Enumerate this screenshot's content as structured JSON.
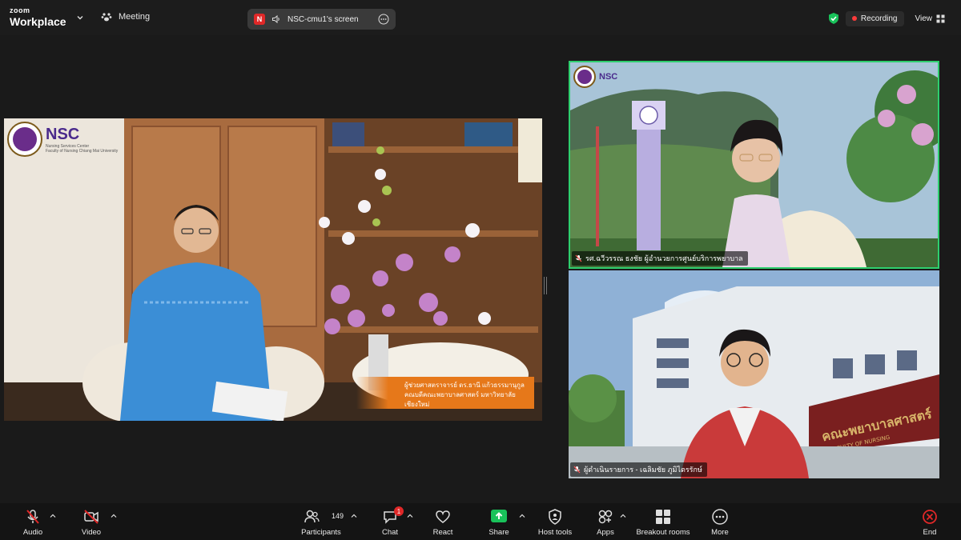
{
  "app": {
    "brand_small": "zoom",
    "brand_large": "Workplace"
  },
  "header": {
    "meeting_label": "Meeting",
    "share_badge": "N",
    "share_label": "NSC-cmu1's screen",
    "recording_label": "Recording",
    "view_label": "View"
  },
  "main_video": {
    "logo_text": "NSC",
    "logo_sub1": "Nursing Services Center",
    "logo_sub2": "Faculty of Nursing Chiang Mai University",
    "banner_line1": "ผู้ช่วยศาสตราจารย์ ดร.ธานี แก้วธรรมานุกูล",
    "banner_line2": "คณบดีคณะพยาบาลศาสตร์ มหาวิทยาลัยเชียงใหม่"
  },
  "tiles": [
    {
      "name": "รศ.ฉวีวรรณ ธงชัย ผู้อำนวยการศูนย์บริการพยาบาล",
      "logo_text": "NSC",
      "active": true
    },
    {
      "name": "ผู้ดำเนินรายการ - เฉลิมชัย ภูมิไตรรักษ์",
      "sign_text": "คณะพยาบาลศาสตร์",
      "sign_sub": "FACULTY OF NURSING"
    }
  ],
  "toolbar": {
    "audio": "Audio",
    "video": "Video",
    "participants": "Participants",
    "participants_count": "149",
    "chat": "Chat",
    "chat_badge": "1",
    "react": "React",
    "share": "Share",
    "host_tools": "Host tools",
    "apps": "Apps",
    "breakout": "Breakout rooms",
    "more": "More",
    "end": "End"
  },
  "colors": {
    "active_speaker": "#2ecf6e",
    "share_green": "#19c25a",
    "recording": "#ff3b3b",
    "end": "#e02828"
  }
}
